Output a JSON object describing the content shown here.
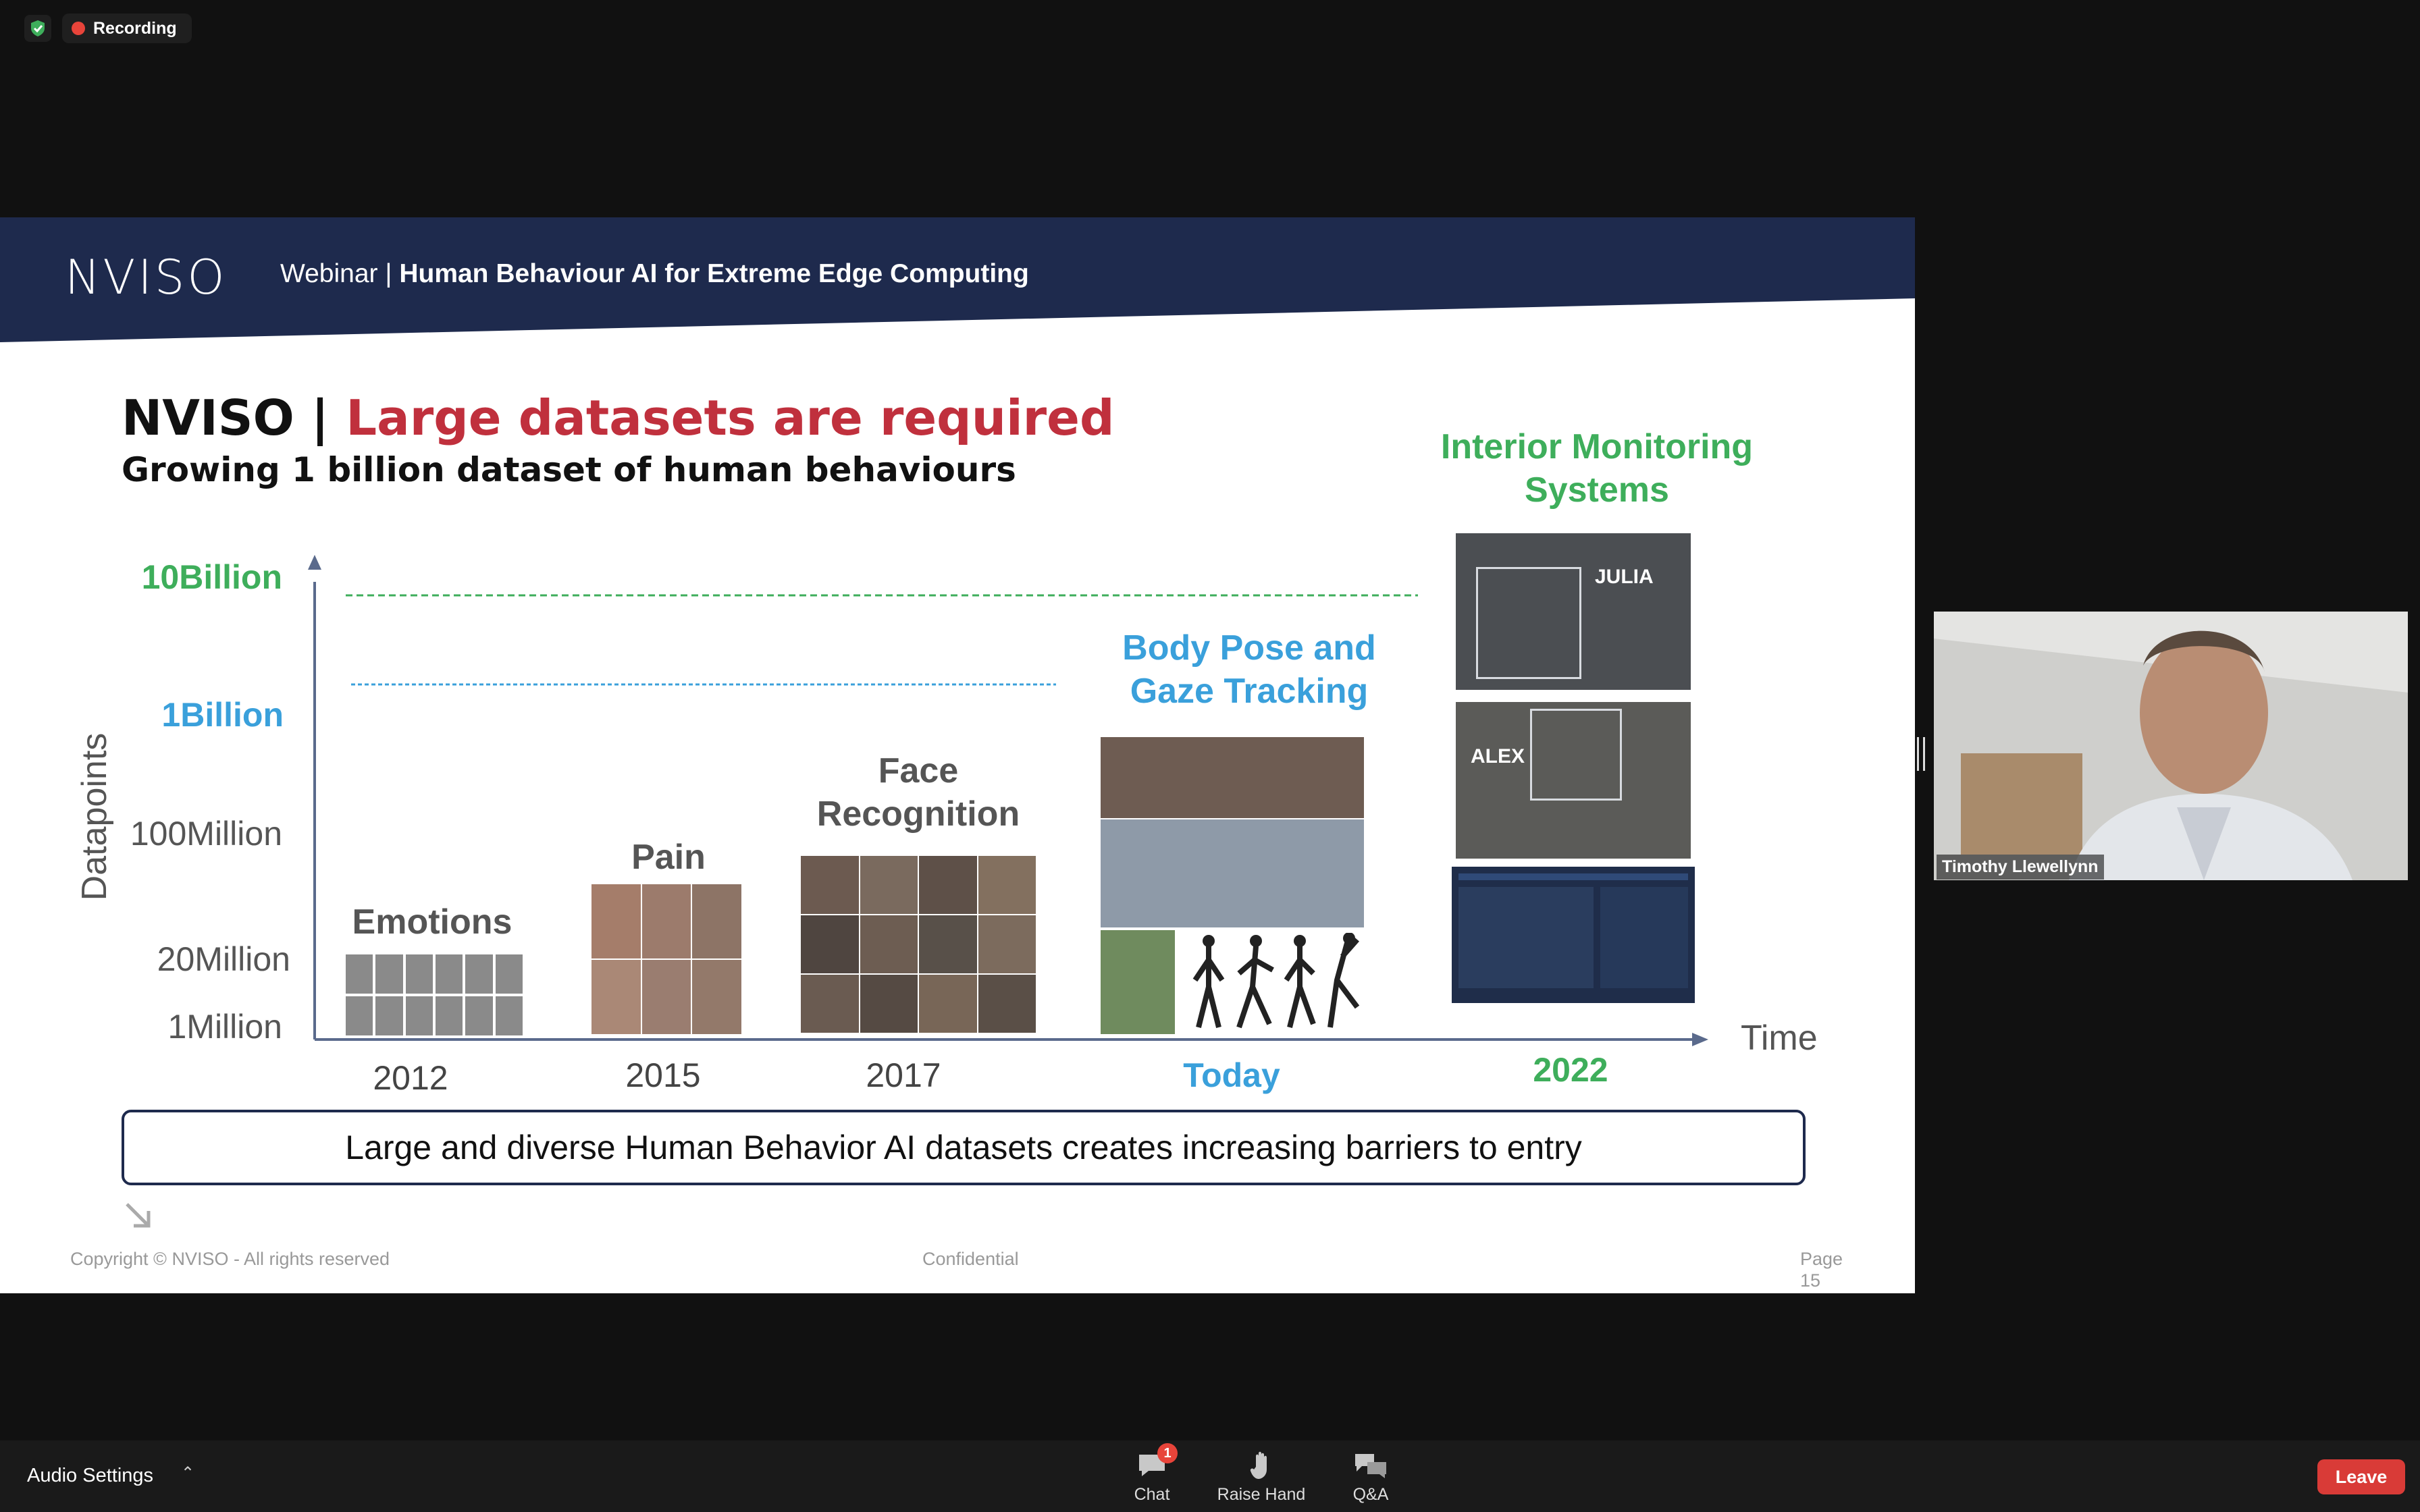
{
  "status": {
    "recording_label": "Recording",
    "accent_color": "#e8443a"
  },
  "slide": {
    "logo": "NVISO",
    "banner_prefix": "Webinar |",
    "banner_title": "Human Behaviour AI for Extreme Edge Computing",
    "title_brand": "NVISO |",
    "title_highlight": "Large datasets are required",
    "subtitle": "Growing 1 billion dataset of human behaviours",
    "y_axis_title": "Datapoints",
    "x_axis_title": "Time",
    "y_labels": {
      "ten_billion": "10Billion",
      "one_billion": "1Billion",
      "hundred_million": "100Million",
      "twenty_million": "20Million",
      "one_million": "1Million"
    },
    "x_labels": {
      "y2012": "2012",
      "y2015": "2015",
      "y2017": "2017",
      "today": "Today",
      "y2022": "2022"
    },
    "categories": {
      "emotions": "Emotions",
      "pain": "Pain",
      "face_recognition": "Face Recognition",
      "body_pose": "Body Pose and Gaze Tracking",
      "interior": "Interior Monitoring Systems"
    },
    "image_overlays": {
      "julia": "JULIA",
      "alex": "ALEX"
    },
    "callout": "Large and diverse Human Behavior AI datasets creates increasing barriers to entry",
    "footer_copyright": "Copyright © NVISO - All rights reserved",
    "footer_confidential": "Confidential",
    "footer_page_label": "Page",
    "footer_page_number": "15",
    "colors": {
      "banner": "#1e2a4d",
      "red": "#c0303d",
      "blue": "#3aa0db",
      "green": "#3eae5b"
    }
  },
  "participant": {
    "name": "Timothy Llewellynn"
  },
  "controls": {
    "audio_settings": "Audio Settings",
    "chat": "Chat",
    "chat_badge": "1",
    "raise_hand": "Raise Hand",
    "qa": "Q&A",
    "leave": "Leave"
  }
}
